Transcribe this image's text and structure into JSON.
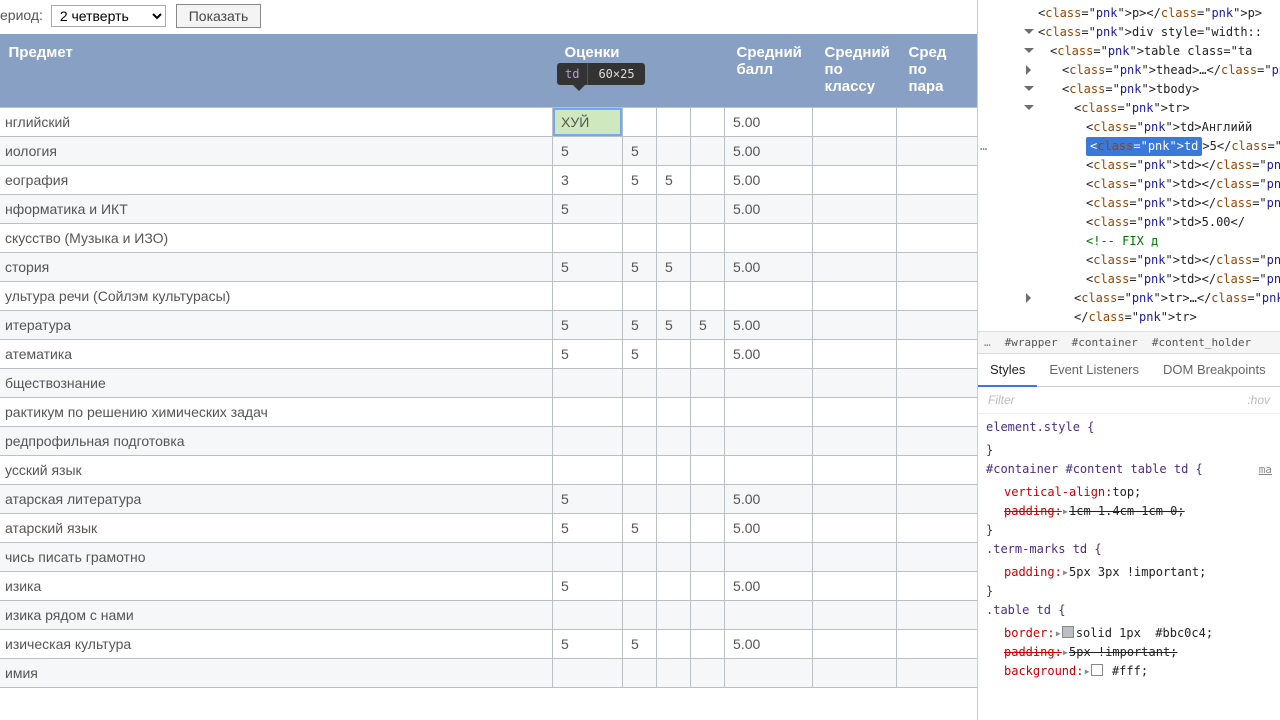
{
  "toolbar": {
    "period_label": "ериод:",
    "period_value": "2 четверть",
    "show_button": "Показать"
  },
  "headers": {
    "subject": "Предмет",
    "marks": "Оценки",
    "avg": "Средний\nбалл",
    "avg_class": "Средний\nпо\nклассу",
    "avg_par": "Сред\nпо\nпара"
  },
  "tooltip": {
    "tag": "td",
    "dim": "60×25"
  },
  "rows": [
    {
      "subject": "нглийский",
      "m": [
        "ХУЙ",
        "",
        "",
        ""
      ],
      "avg": "5.00"
    },
    {
      "subject": "иология",
      "m": [
        "5",
        "5",
        "",
        ""
      ],
      "avg": "5.00"
    },
    {
      "subject": "еография",
      "m": [
        "3",
        "5",
        "5",
        ""
      ],
      "avg": "5.00"
    },
    {
      "subject": "нформатика и ИКТ",
      "m": [
        "5",
        "",
        "",
        ""
      ],
      "avg": "5.00"
    },
    {
      "subject": "скусство (Музыка и ИЗО)",
      "m": [
        "",
        "",
        "",
        ""
      ],
      "avg": ""
    },
    {
      "subject": "стория",
      "m": [
        "5",
        "5",
        "5",
        ""
      ],
      "avg": "5.00"
    },
    {
      "subject": "ультура речи (Сойлэм культурасы)",
      "m": [
        "",
        "",
        "",
        ""
      ],
      "avg": ""
    },
    {
      "subject": "итература",
      "m": [
        "5",
        "5",
        "5",
        "5"
      ],
      "avg": "5.00"
    },
    {
      "subject": "атематика",
      "m": [
        "5",
        "5",
        "",
        ""
      ],
      "avg": "5.00"
    },
    {
      "subject": "бществознание",
      "m": [
        "",
        "",
        "",
        ""
      ],
      "avg": ""
    },
    {
      "subject": "рактикум по решению химических задач",
      "m": [
        "",
        "",
        "",
        ""
      ],
      "avg": ""
    },
    {
      "subject": "редпрофильная подготовка",
      "m": [
        "",
        "",
        "",
        ""
      ],
      "avg": ""
    },
    {
      "subject": "усский язык",
      "m": [
        "",
        "",
        "",
        ""
      ],
      "avg": ""
    },
    {
      "subject": "атарская литература",
      "m": [
        "5",
        "",
        "",
        ""
      ],
      "avg": "5.00"
    },
    {
      "subject": "атарский язык",
      "m": [
        "5",
        "5",
        "",
        ""
      ],
      "avg": "5.00"
    },
    {
      "subject": "чись писать грамотно",
      "m": [
        "",
        "",
        "",
        ""
      ],
      "avg": ""
    },
    {
      "subject": "изика",
      "m": [
        "5",
        "",
        "",
        ""
      ],
      "avg": "5.00"
    },
    {
      "subject": "изика рядом с нами",
      "m": [
        "",
        "",
        "",
        ""
      ],
      "avg": ""
    },
    {
      "subject": "изическая культура",
      "m": [
        "5",
        "5",
        "",
        ""
      ],
      "avg": "5.00"
    },
    {
      "subject": "имия",
      "m": [
        "",
        "",
        "",
        ""
      ],
      "avg": ""
    }
  ],
  "devtools": {
    "elements": [
      {
        "ind": 0,
        "html": "<p></p>"
      },
      {
        "ind": 0,
        "tri": "down",
        "html": "<div style=\"width::"
      },
      {
        "ind": 1,
        "tri": "down",
        "html": "<table class=\"ta"
      },
      {
        "ind": 2,
        "tri": "right",
        "html": "<thead>…</thea"
      },
      {
        "ind": 2,
        "tri": "down",
        "html": "<tbody>"
      },
      {
        "ind": 3,
        "tri": "down",
        "html": "<tr>"
      },
      {
        "ind": 4,
        "html": "<td>Английй"
      },
      {
        "ind": 4,
        "sel": true,
        "dots": "…",
        "html": "<td>5</td>"
      },
      {
        "ind": 4,
        "html": "<td></td>"
      },
      {
        "ind": 4,
        "html": "<td></td>"
      },
      {
        "ind": 4,
        "html": "<td></td>"
      },
      {
        "ind": 4,
        "html": "<td>5.00</"
      },
      {
        "ind": 4,
        "cmt": true,
        "html": "<!-- FIX д"
      },
      {
        "ind": 4,
        "html": "<td></td>"
      },
      {
        "ind": 4,
        "html": "<td></td>"
      },
      {
        "ind": 3,
        "tri": "right",
        "html": "<tr>…</tr>"
      },
      {
        "ind": 3,
        "html": "</tr>"
      }
    ],
    "crumbs": [
      "…",
      "#wrapper",
      "#container",
      "#content_holder"
    ],
    "tabs": [
      "Styles",
      "Event Listeners",
      "DOM Breakpoints"
    ],
    "filter_placeholder": "Filter",
    "filter_right": ":hov",
    "styles": [
      {
        "selector": "element.style {",
        "link": "",
        "props": []
      },
      {
        "close": "}"
      },
      {
        "selector": "#container #content table td {",
        "link": "ma",
        "props": [
          {
            "name": "vertical-align",
            "val": "top;"
          },
          {
            "name": "padding",
            "val": "1cm 1.4cm 1cm 0;",
            "strike": true,
            "arrow": true
          }
        ]
      },
      {
        "close": "}"
      },
      {
        "selector": ".term-marks td {",
        "props": [
          {
            "name": "padding",
            "val": "5px 3px !important;",
            "arrow": true
          }
        ]
      },
      {
        "close": "}"
      },
      {
        "selector": ".table td {",
        "props": [
          {
            "name": "border",
            "val": "solid 1px  #bbc0c4;",
            "arrow": true,
            "swatch": "#bbc0c4"
          },
          {
            "name": "padding",
            "val": "5px !important;",
            "strike": true,
            "arrow": true
          },
          {
            "name": "background",
            "val": " #fff;",
            "arrow": true,
            "swatch": "#ffffff"
          }
        ]
      }
    ]
  }
}
